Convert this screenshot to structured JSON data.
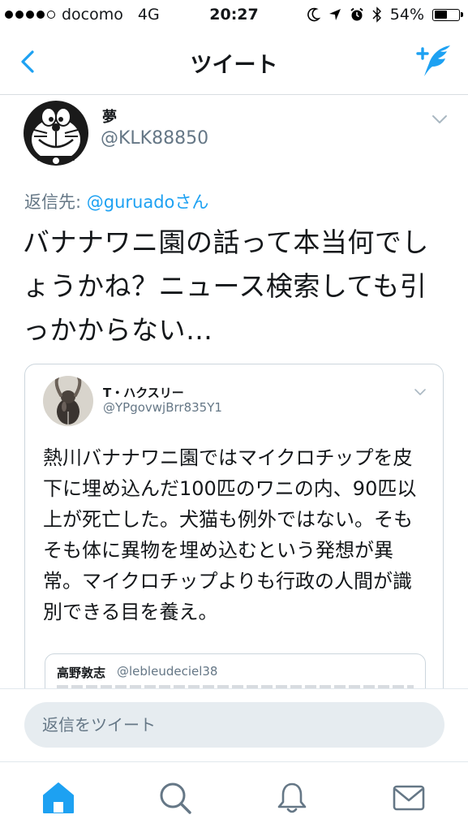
{
  "status_bar": {
    "carrier": "docomo",
    "network": "4G",
    "time": "20:27",
    "battery_percent": "54%",
    "battery_level": 0.54,
    "signal_bars_filled": 4,
    "signal_bars_total": 5
  },
  "nav": {
    "title": "ツイート",
    "back_icon": "chevron-left-icon",
    "compose_icon": "compose-tweet-icon"
  },
  "tweet": {
    "display_name": "夢",
    "handle": "@KLK88850",
    "reply_prefix": "返信先: ",
    "reply_to": "@guruadoさん",
    "text": "バナナワニ園の話って本当何でしょうかね？ニュース検索しても引っかからない…"
  },
  "quoted_tweet": {
    "display_name": "T・ハクスリー",
    "handle": "@YPgovwjBrr835Y1",
    "text": "熱川バナナワニ園ではマイクロチップを皮下に埋め込んだ100匹のワニの内、90匹以上が死亡した。犬猫も例外ではない。そもそも体に異物を埋め込むという発想が異常。マイクロチップよりも行政の人間が識別できる目を養え。",
    "nested_quote": {
      "display_name": "高野敦志",
      "handle": "@lebleudeciel38"
    }
  },
  "reply_box": {
    "placeholder": "返信をツイート"
  },
  "tab_bar": {
    "tabs": [
      {
        "icon": "home-icon",
        "active": true
      },
      {
        "icon": "search-icon",
        "active": false
      },
      {
        "icon": "notifications-bell-icon",
        "active": false
      },
      {
        "icon": "messages-envelope-icon",
        "active": false
      }
    ]
  },
  "colors": {
    "accent": "#1da1f2",
    "text_primary": "#14171a",
    "text_secondary": "#657786",
    "border": "#ccd6dd",
    "input_bg": "#e6ecf0"
  }
}
